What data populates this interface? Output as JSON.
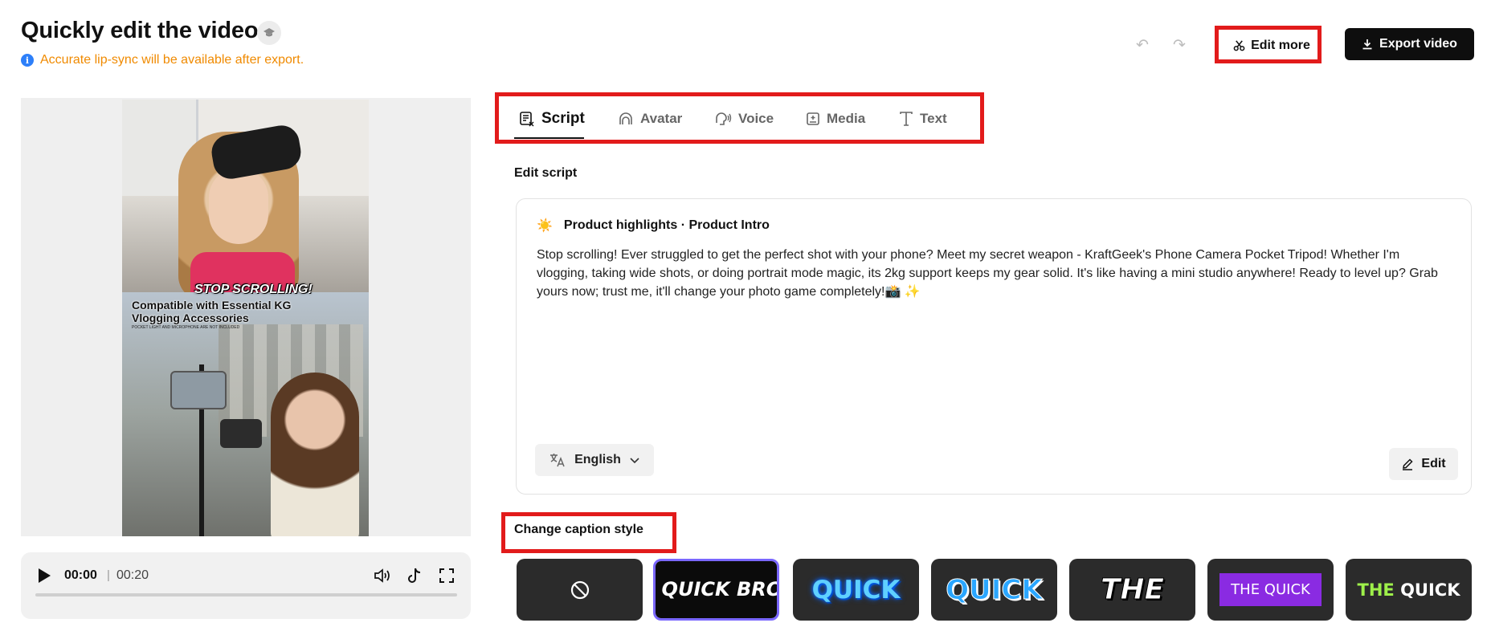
{
  "header": {
    "title": "Quickly edit the video",
    "notice": "Accurate lip-sync will be available after export.",
    "edit_more_label": "Edit more",
    "export_label": "Export video"
  },
  "video": {
    "caption_main": "STOP SCROLLING!",
    "caption_sub": "Compatible with Essential KG Vlogging Accessories",
    "caption_fine": "POCKET LIGHT AND MICROPHONE ARE NOT INCLUDED"
  },
  "player": {
    "current_time": "00:00",
    "separator": "|",
    "total_time": "00:20",
    "progress": 0
  },
  "tabs": [
    {
      "label": "Script",
      "icon": "script-icon",
      "active": true
    },
    {
      "label": "Avatar",
      "icon": "avatar-icon",
      "active": false
    },
    {
      "label": "Voice",
      "icon": "voice-icon",
      "active": false
    },
    {
      "label": "Media",
      "icon": "media-icon",
      "active": false
    },
    {
      "label": "Text",
      "icon": "text-icon",
      "active": false
    }
  ],
  "script": {
    "section_label": "Edit script",
    "heading_emoji": "☀️",
    "heading": "Product highlights · Product Intro",
    "body": "Stop scrolling! Ever struggled to get the perfect shot with your phone? Meet my secret weapon - KraftGeek's Phone Camera Pocket Tripod! Whether I'm vlogging, taking wide shots, or doing portrait mode magic, its 2kg support keeps my gear solid. It's like having a mini studio anywhere! Ready to level up? Grab yours now; trust me, it'll change your photo game completely!📸 ✨",
    "language": "English",
    "edit_label": "Edit"
  },
  "captions": {
    "label": "Change caption style",
    "styles": [
      {
        "text": "",
        "icon": "none-icon"
      },
      {
        "text": "THE QUICK BROWN",
        "selected": true
      },
      {
        "text": "QUICK"
      },
      {
        "text": "QUICK"
      },
      {
        "text": "THE"
      },
      {
        "text": "THE QUICK"
      },
      {
        "text": "THE QUICK"
      }
    ]
  },
  "colors": {
    "accent_red": "#e21b1b",
    "notice_orange": "#f08a00",
    "selected_border": "#7a67ff",
    "export_bg": "#0e0e0e"
  }
}
